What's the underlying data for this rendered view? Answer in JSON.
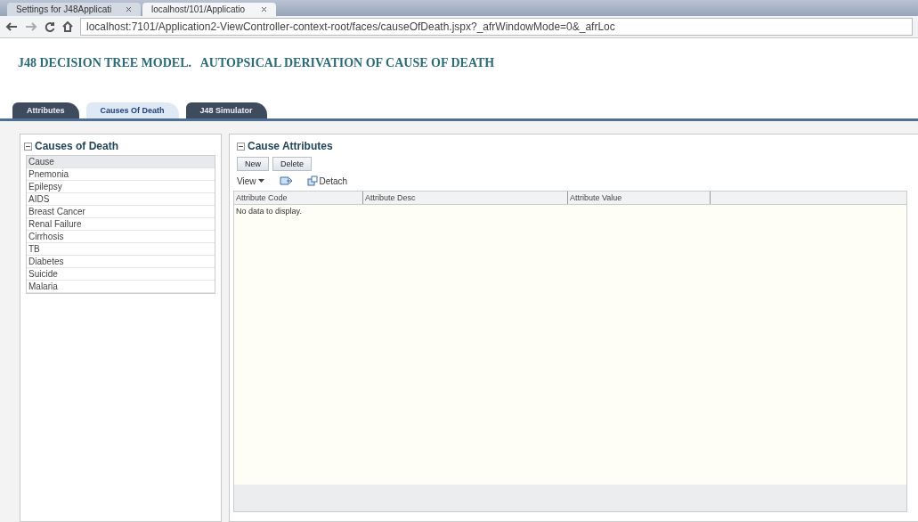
{
  "browser": {
    "tabs": [
      {
        "label": "Settings for J48Applicati",
        "selected": false
      },
      {
        "label": "localhost/101/Applicatio",
        "selected": true
      }
    ],
    "address": "localhost:7101/Application2-ViewController-context-root/faces/causeOfDeath.jspx?_afrWindowMode=0&_afrLoc"
  },
  "page_title": "J48 DECISION TREE MODEL.   AUTOPSICAL DERIVATION OF CAUSE OF DEATH",
  "tabs": [
    {
      "label": "Attributes",
      "selected": false
    },
    {
      "label": "Causes Of Death",
      "selected": true
    },
    {
      "label": "J48 Simulator",
      "selected": false
    }
  ],
  "causes_panel": {
    "title": "Causes of Death",
    "items": [
      {
        "label": "Cause",
        "selected": true
      },
      {
        "label": "Pnemonia",
        "selected": false
      },
      {
        "label": "Epilepsy",
        "selected": false
      },
      {
        "label": "AIDS",
        "selected": false
      },
      {
        "label": "Breast Cancer",
        "selected": false
      },
      {
        "label": "Renal Failure",
        "selected": false
      },
      {
        "label": "Cirrhosis",
        "selected": false
      },
      {
        "label": "TB",
        "selected": false
      },
      {
        "label": "Diabetes",
        "selected": false
      },
      {
        "label": "Suicide",
        "selected": false
      },
      {
        "label": "Malaria",
        "selected": false
      }
    ]
  },
  "attributes_panel": {
    "title": "Cause Attributes",
    "buttons": [
      "New",
      "Delete"
    ],
    "view_menu": "View",
    "detach": "Detach",
    "table": {
      "columns": [
        "Attribute Code",
        "Attribute Desc",
        "Attribute Value"
      ],
      "empty_text": "No data to display."
    }
  }
}
